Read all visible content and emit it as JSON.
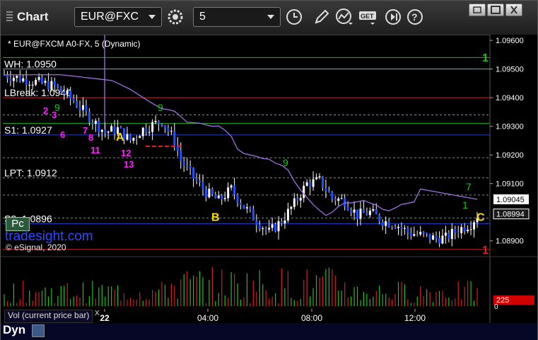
{
  "window": {
    "title": "Chart",
    "symbol": "EUR@FXC",
    "interval": "5",
    "subtitle": "* EUR@FXCM A0-FX, 5 (Dynamic)",
    "icons": [
      "settings-gear-icon",
      "clock-icon",
      "pencil-icon",
      "study-chart-icon",
      "get-data-icon",
      "step-forward-icon",
      "help-icon",
      "restore-icon",
      "maximize-icon",
      "close-icon"
    ]
  },
  "levels": [
    {
      "label": "WH: 1.0950",
      "price": 1.095,
      "color": "#40c0e0"
    },
    {
      "label": "LBreak: 1.0940",
      "price": 1.094,
      "color": "#d02020"
    },
    {
      "label": "S1: 1.0927",
      "price": 1.0927,
      "color": "#2040d0"
    },
    {
      "label": "LPT: 1.0912",
      "price": 1.0912,
      "color": "#888888",
      "dash": true
    },
    {
      "label": "S2: 1.0896",
      "price": 1.0896,
      "color": "#2040d0"
    }
  ],
  "extra_lines": [
    {
      "price": 1.0954,
      "color": "#20b020"
    },
    {
      "price": 1.0931,
      "color": "#20b020"
    },
    {
      "price": 1.0934,
      "color": "#888888",
      "dash": true
    },
    {
      "price": 1.0919,
      "color": "#888888",
      "dash": true
    },
    {
      "price": 1.0906,
      "color": "#888888",
      "dash": true
    },
    {
      "price": 1.0898,
      "color": "#888888",
      "dash": true
    },
    {
      "price": 1.0887,
      "color": "#d02020"
    }
  ],
  "annotations": {
    "A": "A",
    "B": "B",
    "C": "C",
    "green1_top": "1",
    "red1_bottom": "1",
    "td_green": [
      "9",
      "9",
      "9",
      "7",
      "1"
    ],
    "td_magenta": [
      "2",
      "3",
      "6",
      "7",
      "8",
      "11",
      "12",
      "13"
    ]
  },
  "price_tags": {
    "last_purple": "1.09045",
    "last_white": "1.08994"
  },
  "watermark": {
    "pc": "Pc",
    "brand": "tradesight.com",
    "copyright": "© eSignal, 2020"
  },
  "volume": {
    "label": "Vol (current price bar)",
    "close": "x",
    "current_value": "225",
    "zero_label": "0"
  },
  "bottom": {
    "mode": "Dyn"
  },
  "chart_data": {
    "type": "candlestick",
    "title": "",
    "y_ticks": [
      "1.09600",
      "1.09500",
      "1.09400",
      "1.09300",
      "1.09200",
      "1.09100",
      "1.08900"
    ],
    "ylim": [
      1.0885,
      1.0962
    ],
    "x_ticks": [
      "22",
      "04:00",
      "08:00",
      "12:00"
    ],
    "series_line_name": "",
    "approx_close_path": [
      [
        0,
        1.0948
      ],
      [
        8,
        1.0946
      ],
      [
        16,
        1.0944
      ],
      [
        22,
        1.0939
      ],
      [
        28,
        1.0932
      ],
      [
        32,
        1.0928
      ],
      [
        36,
        1.0929
      ],
      [
        40,
        1.0925
      ],
      [
        44,
        1.0929
      ],
      [
        50,
        1.0932
      ],
      [
        54,
        1.0925
      ],
      [
        56,
        1.0918
      ],
      [
        60,
        1.0912
      ],
      [
        64,
        1.0907
      ],
      [
        68,
        1.0904
      ],
      [
        72,
        1.0908
      ],
      [
        76,
        1.0902
      ],
      [
        80,
        1.0897
      ],
      [
        84,
        1.0893
      ],
      [
        88,
        1.0897
      ],
      [
        92,
        1.0903
      ],
      [
        96,
        1.091
      ],
      [
        100,
        1.0911
      ],
      [
        104,
        1.0905
      ],
      [
        108,
        1.0904
      ],
      [
        112,
        1.0899
      ],
      [
        116,
        1.09
      ],
      [
        120,
        1.0897
      ],
      [
        124,
        1.0896
      ],
      [
        128,
        1.0893
      ],
      [
        132,
        1.0892
      ],
      [
        136,
        1.0891
      ],
      [
        140,
        1.0891
      ],
      [
        144,
        1.0894
      ],
      [
        148,
        1.0896
      ],
      [
        150,
        1.0899
      ]
    ],
    "ma_line_end": 1.09045,
    "last_price": 1.08994,
    "volume_current": 225
  }
}
